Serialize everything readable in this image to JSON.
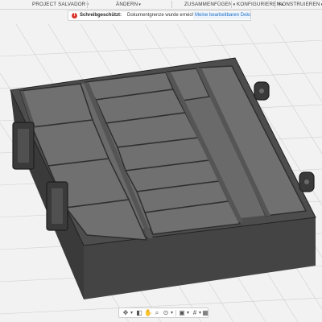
{
  "toolbar": {
    "project": "PROJECT SALVADOR",
    "modify": "ÄNDERN",
    "assemble": "ZUSAMMENFÜGEN",
    "configure": "KONFIGURIEREN",
    "construct": "KONSTRUIEREN",
    "caret": "▾"
  },
  "notice": {
    "icon": "!",
    "label": "Schreibgeschützt:",
    "message": "Dokumentgrenze wurde erreicht",
    "link": "Meine bearbeitbaren Dokume..."
  },
  "navbar": {
    "icons": [
      "move-icon",
      "camera-icon",
      "hand-icon",
      "zoom-icon",
      "zoom-window-icon",
      "display-icon",
      "grid-icon",
      "layout-icon"
    ]
  },
  "colors": {
    "background": "#f2f2f2",
    "grid": "#cfcfcf",
    "box_side": "#3c3c3c",
    "box_top": "#4a4a4a",
    "compartment_floor": "#6f6f6f",
    "divider": "#595959",
    "alert": "#d9382f",
    "link": "#1a6fc9"
  }
}
